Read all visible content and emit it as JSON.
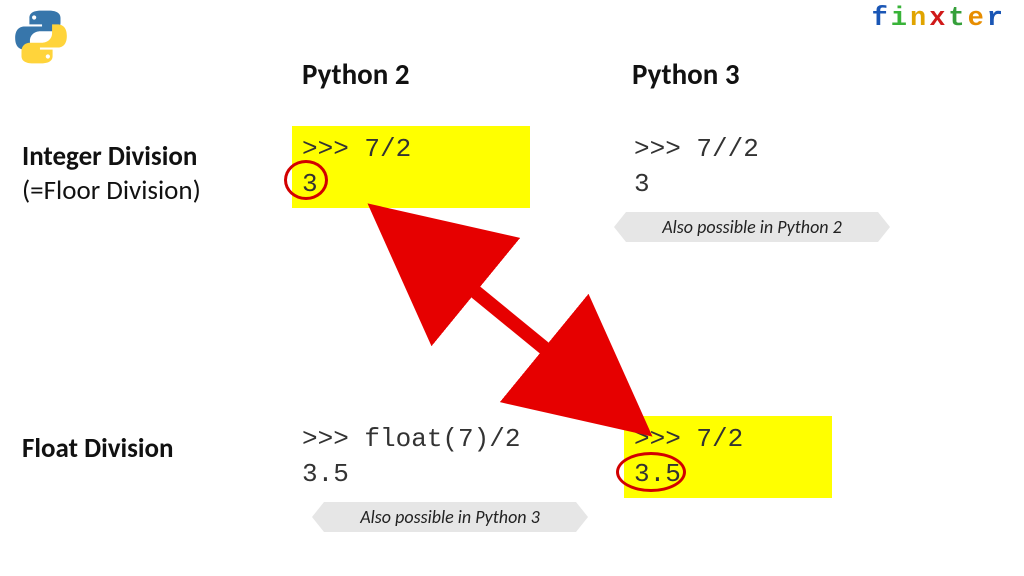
{
  "brand": {
    "letters": [
      "f",
      "i",
      "n",
      "x",
      "t",
      "e",
      "r"
    ],
    "colors": [
      "#1a56b5",
      "#39b339",
      "#e0a400",
      "#d01919",
      "#35a03a",
      "#e78d00",
      "#1a56b5"
    ]
  },
  "columns": {
    "py2": "Python 2",
    "py3": "Python 3"
  },
  "rows": {
    "int": {
      "title": "Integer Division",
      "subtitle": "(=Floor Division)"
    },
    "float": {
      "title": "Float Division"
    }
  },
  "cells": {
    "int_py2": {
      "line1": ">>> 7/2",
      "line2": "3"
    },
    "int_py3": {
      "line1": ">>> 7//2",
      "line2": "3"
    },
    "float_py2": {
      "line1": ">>> float(7)/2",
      "line2": "3.5"
    },
    "float_py3": {
      "line1": ">>> 7/2",
      "line2": "3.5"
    }
  },
  "ribbons": {
    "also_py2": "Also possible in Python 2",
    "also_py3": "Also possible in Python 3"
  }
}
